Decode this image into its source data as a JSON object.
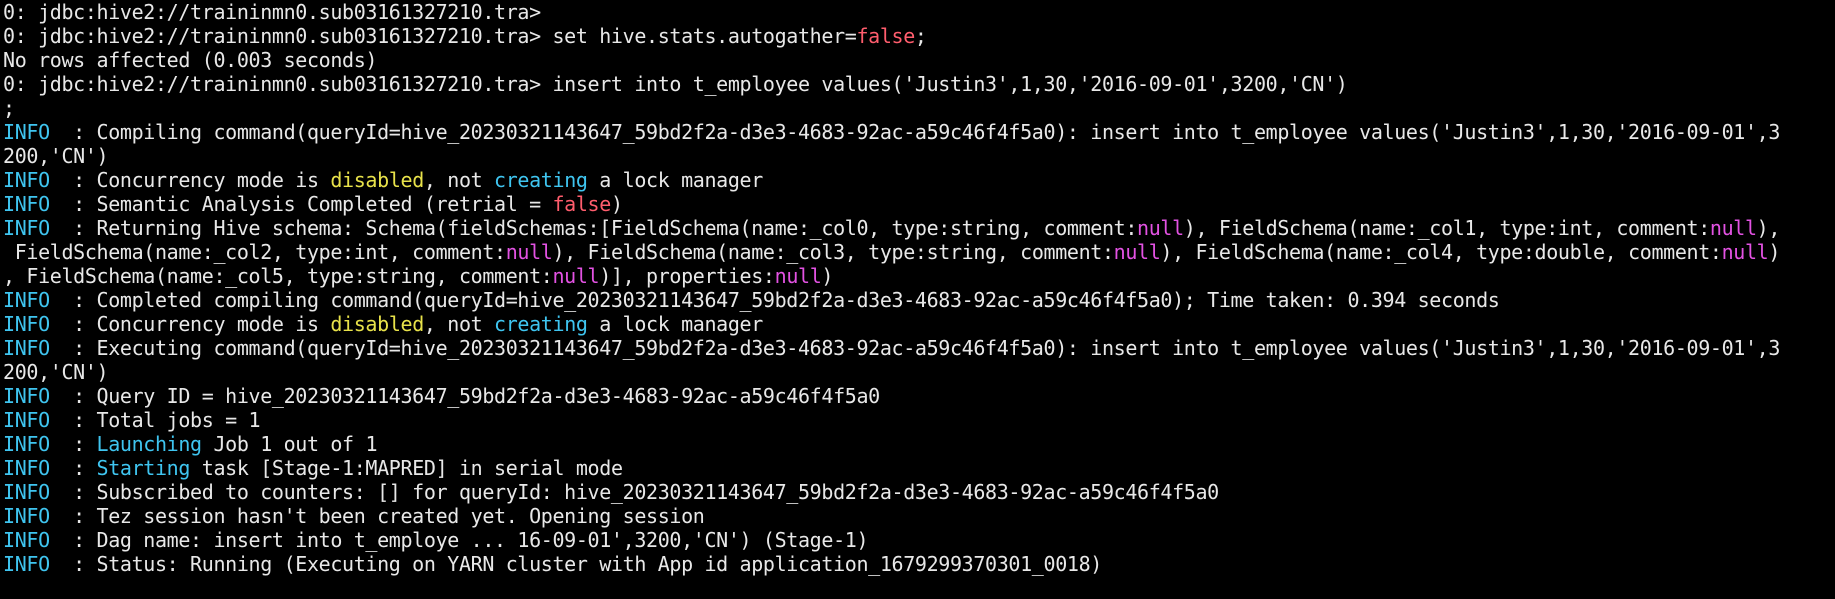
{
  "colors": {
    "default": "#e8e8e8",
    "info": "#3fc5f0",
    "keyword_false": "#ff5d6d",
    "null_value": "#e352e3",
    "warn_word": "#e8e24a",
    "action_word": "#3fc5f0"
  },
  "lines": [
    [
      {
        "t": "0: jdbc:hive2://traininmn0.sub03161327210.tra>"
      }
    ],
    [
      {
        "t": "0: jdbc:hive2://traininmn0.sub03161327210.tra> set hive.stats.autogather="
      },
      {
        "t": "false",
        "c": "keyword_false"
      },
      {
        "t": ";"
      }
    ],
    [
      {
        "t": "No rows affected (0.003 seconds)"
      }
    ],
    [
      {
        "t": "0: jdbc:hive2://traininmn0.sub03161327210.tra> insert into t_employee values('Justin3',1,30,'2016-09-01',3200,'CN')"
      }
    ],
    [
      {
        "t": ";"
      }
    ],
    [
      {
        "t": "INFO",
        "c": "info"
      },
      {
        "t": "  : Compiling command(queryId=hive_20230321143647_59bd2f2a-d3e3-4683-92ac-a59c46f4f5a0): insert into t_employee values('Justin3',1,30,'2016-09-01',3"
      }
    ],
    [
      {
        "t": "200,'CN')"
      }
    ],
    [
      {
        "t": "INFO",
        "c": "info"
      },
      {
        "t": "  : Concurrency mode is "
      },
      {
        "t": "disabled",
        "c": "warn_word"
      },
      {
        "t": ", not "
      },
      {
        "t": "creating",
        "c": "action_word"
      },
      {
        "t": " a lock manager"
      }
    ],
    [
      {
        "t": "INFO",
        "c": "info"
      },
      {
        "t": "  : Semantic Analysis Completed (retrial = "
      },
      {
        "t": "false",
        "c": "keyword_false"
      },
      {
        "t": ")"
      }
    ],
    [
      {
        "t": "INFO",
        "c": "info"
      },
      {
        "t": "  : Returning Hive schema: Schema(fieldSchemas:[FieldSchema(name:_col0, type:string, comment:"
      },
      {
        "t": "null",
        "c": "null_value"
      },
      {
        "t": "), FieldSchema(name:_col1, type:int, comment:"
      },
      {
        "t": "null",
        "c": "null_value"
      },
      {
        "t": "),"
      }
    ],
    [
      {
        "t": " FieldSchema(name:_col2, type:int, comment:"
      },
      {
        "t": "null",
        "c": "null_value"
      },
      {
        "t": "), FieldSchema(name:_col3, type:string, comment:"
      },
      {
        "t": "null",
        "c": "null_value"
      },
      {
        "t": "), FieldSchema(name:_col4, type:double, comment:"
      },
      {
        "t": "null",
        "c": "null_value"
      },
      {
        "t": ")"
      }
    ],
    [
      {
        "t": ", FieldSchema(name:_col5, type:string, comment:"
      },
      {
        "t": "null",
        "c": "null_value"
      },
      {
        "t": ")], properties:"
      },
      {
        "t": "null",
        "c": "null_value"
      },
      {
        "t": ")"
      }
    ],
    [
      {
        "t": "INFO",
        "c": "info"
      },
      {
        "t": "  : Completed compiling command(queryId=hive_20230321143647_59bd2f2a-d3e3-4683-92ac-a59c46f4f5a0); Time taken: 0.394 seconds"
      }
    ],
    [
      {
        "t": "INFO",
        "c": "info"
      },
      {
        "t": "  : Concurrency mode is "
      },
      {
        "t": "disabled",
        "c": "warn_word"
      },
      {
        "t": ", not "
      },
      {
        "t": "creating",
        "c": "action_word"
      },
      {
        "t": " a lock manager"
      }
    ],
    [
      {
        "t": "INFO",
        "c": "info"
      },
      {
        "t": "  : Executing command(queryId=hive_20230321143647_59bd2f2a-d3e3-4683-92ac-a59c46f4f5a0): insert into t_employee values('Justin3',1,30,'2016-09-01',3"
      }
    ],
    [
      {
        "t": "200,'CN')"
      }
    ],
    [
      {
        "t": "INFO",
        "c": "info"
      },
      {
        "t": "  : Query ID = hive_20230321143647_59bd2f2a-d3e3-4683-92ac-a59c46f4f5a0"
      }
    ],
    [
      {
        "t": "INFO",
        "c": "info"
      },
      {
        "t": "  : Total jobs = 1"
      }
    ],
    [
      {
        "t": "INFO",
        "c": "info"
      },
      {
        "t": "  : "
      },
      {
        "t": "Launching",
        "c": "action_word"
      },
      {
        "t": " Job 1 out of 1"
      }
    ],
    [
      {
        "t": "INFO",
        "c": "info"
      },
      {
        "t": "  : "
      },
      {
        "t": "Starting",
        "c": "action_word"
      },
      {
        "t": " task [Stage-1:MAPRED] in serial mode"
      }
    ],
    [
      {
        "t": "INFO",
        "c": "info"
      },
      {
        "t": "  : Subscribed to counters: [] for queryId: hive_20230321143647_59bd2f2a-d3e3-4683-92ac-a59c46f4f5a0"
      }
    ],
    [
      {
        "t": "INFO",
        "c": "info"
      },
      {
        "t": "  : Tez session hasn't been created yet. Opening session"
      }
    ],
    [
      {
        "t": "INFO",
        "c": "info"
      },
      {
        "t": "  : Dag name: insert into t_employe ... 16-09-01',3200,'CN') (Stage-1)"
      }
    ],
    [
      {
        "t": "INFO",
        "c": "info"
      },
      {
        "t": "  : Status: Running (Executing on YARN cluster with App id application_1679299370301_0018)"
      }
    ]
  ]
}
